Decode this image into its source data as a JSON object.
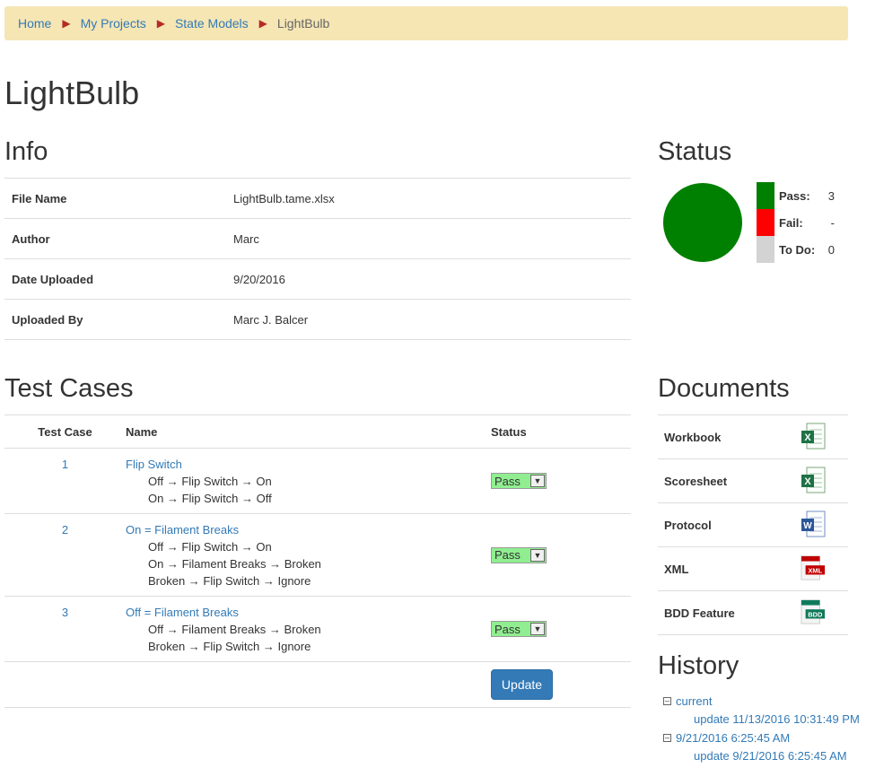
{
  "breadcrumb": {
    "items": [
      "Home",
      "My Projects",
      "State Models"
    ],
    "current": "LightBulb"
  },
  "page_title": "LightBulb",
  "info": {
    "heading": "Info",
    "rows": [
      {
        "label": "File Name",
        "value": "LightBulb.tame.xlsx"
      },
      {
        "label": "Author",
        "value": "Marc"
      },
      {
        "label": "Date Uploaded",
        "value": "9/20/2016"
      },
      {
        "label": "Uploaded By",
        "value": "Marc J. Balcer"
      }
    ]
  },
  "status": {
    "heading": "Status",
    "legend": [
      {
        "label": "Pass:",
        "value": "3",
        "color": "#008000"
      },
      {
        "label": "Fail:",
        "value": "-",
        "color": "#ff0000"
      },
      {
        "label": "To Do:",
        "value": "0",
        "color": "#d3d3d3"
      }
    ],
    "pie_color": "#008000"
  },
  "test_cases": {
    "heading": "Test Cases",
    "columns": [
      "Test Case",
      "Name",
      "Status"
    ],
    "rows": [
      {
        "num": "1",
        "name": "Flip Switch",
        "steps": [
          "Off → Flip Switch → On",
          "On → Flip Switch → Off"
        ],
        "status": "Pass"
      },
      {
        "num": "2",
        "name": "On = Filament Breaks",
        "steps": [
          "Off → Flip Switch → On",
          "On → Filament Breaks → Broken",
          "Broken → Flip Switch → Ignore"
        ],
        "status": "Pass"
      },
      {
        "num": "3",
        "name": "Off = Filament Breaks",
        "steps": [
          "Off → Filament Breaks → Broken",
          "Broken → Flip Switch → Ignore"
        ],
        "status": "Pass"
      }
    ],
    "update_label": "Update"
  },
  "documents": {
    "heading": "Documents",
    "items": [
      {
        "label": "Workbook",
        "icon": "excel-icon"
      },
      {
        "label": "Scoresheet",
        "icon": "excel-icon"
      },
      {
        "label": "Protocol",
        "icon": "word-icon"
      },
      {
        "label": "XML",
        "icon": "xml-icon",
        "badge": "XML"
      },
      {
        "label": "BDD Feature",
        "icon": "bdd-icon",
        "badge": "BDD"
      }
    ]
  },
  "history": {
    "heading": "History",
    "nodes": [
      {
        "label": "current",
        "child": "update 11/13/2016 10:31:49 PM"
      },
      {
        "label": "9/21/2016 6:25:45 AM",
        "child": "update 9/21/2016 6:25:45 AM"
      }
    ]
  }
}
